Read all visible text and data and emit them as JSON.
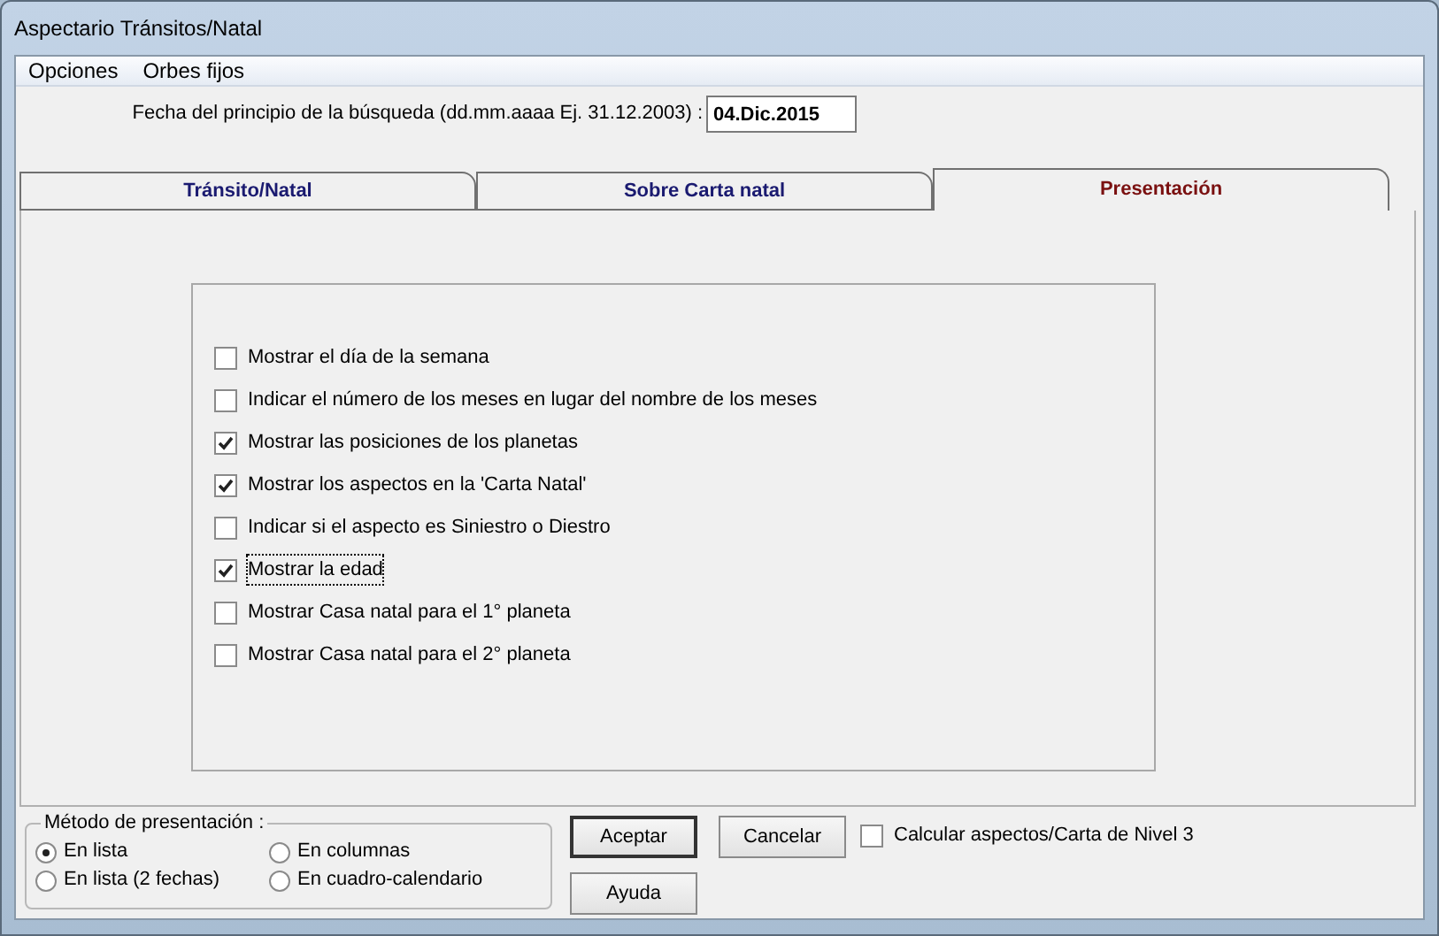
{
  "window": {
    "title": "Aspectario Tránsitos/Natal"
  },
  "menu": [
    "Opciones",
    "Orbes fijos"
  ],
  "date_field": {
    "label": "Fecha del principio de la búsqueda (dd.mm.aaaa Ej. 31.12.2003) :",
    "value": "04.Dic.2015"
  },
  "tabs": [
    {
      "label": "Tránsito/Natal",
      "selected": false
    },
    {
      "label": "Sobre Carta natal",
      "selected": false
    },
    {
      "label": "Presentación",
      "selected": true
    }
  ],
  "options": [
    {
      "label": "Mostrar el día de la semana",
      "checked": false,
      "focused": false
    },
    {
      "label": "Indicar el número de los meses en lugar del nombre de los meses",
      "checked": false,
      "focused": false
    },
    {
      "label": "Mostrar las posiciones de los planetas",
      "checked": true,
      "focused": false
    },
    {
      "label": "Mostrar los aspectos en la 'Carta Natal'",
      "checked": true,
      "focused": false
    },
    {
      "label": "Indicar si el aspecto es Siniestro o Diestro",
      "checked": false,
      "focused": false
    },
    {
      "label": "Mostrar la edad",
      "checked": true,
      "focused": true
    },
    {
      "label": "Mostrar Casa natal para el 1° planeta",
      "checked": false,
      "focused": false
    },
    {
      "label": "Mostrar Casa natal para el 2° planeta",
      "checked": false,
      "focused": false
    }
  ],
  "method_group": {
    "title": "Método de presentación :",
    "options": [
      {
        "label": "En lista",
        "selected": true
      },
      {
        "label": "En columnas",
        "selected": false
      },
      {
        "label": "En lista (2 fechas)",
        "selected": false
      },
      {
        "label": "En cuadro-calendario",
        "selected": false
      }
    ]
  },
  "buttons": [
    {
      "label": "Aceptar",
      "default": true
    },
    {
      "label": "Cancelar",
      "default": false
    },
    {
      "label": "Ayuda",
      "default": false
    }
  ],
  "level3": {
    "label": "Calcular aspectos/Carta de Nivel 3",
    "checked": false
  }
}
